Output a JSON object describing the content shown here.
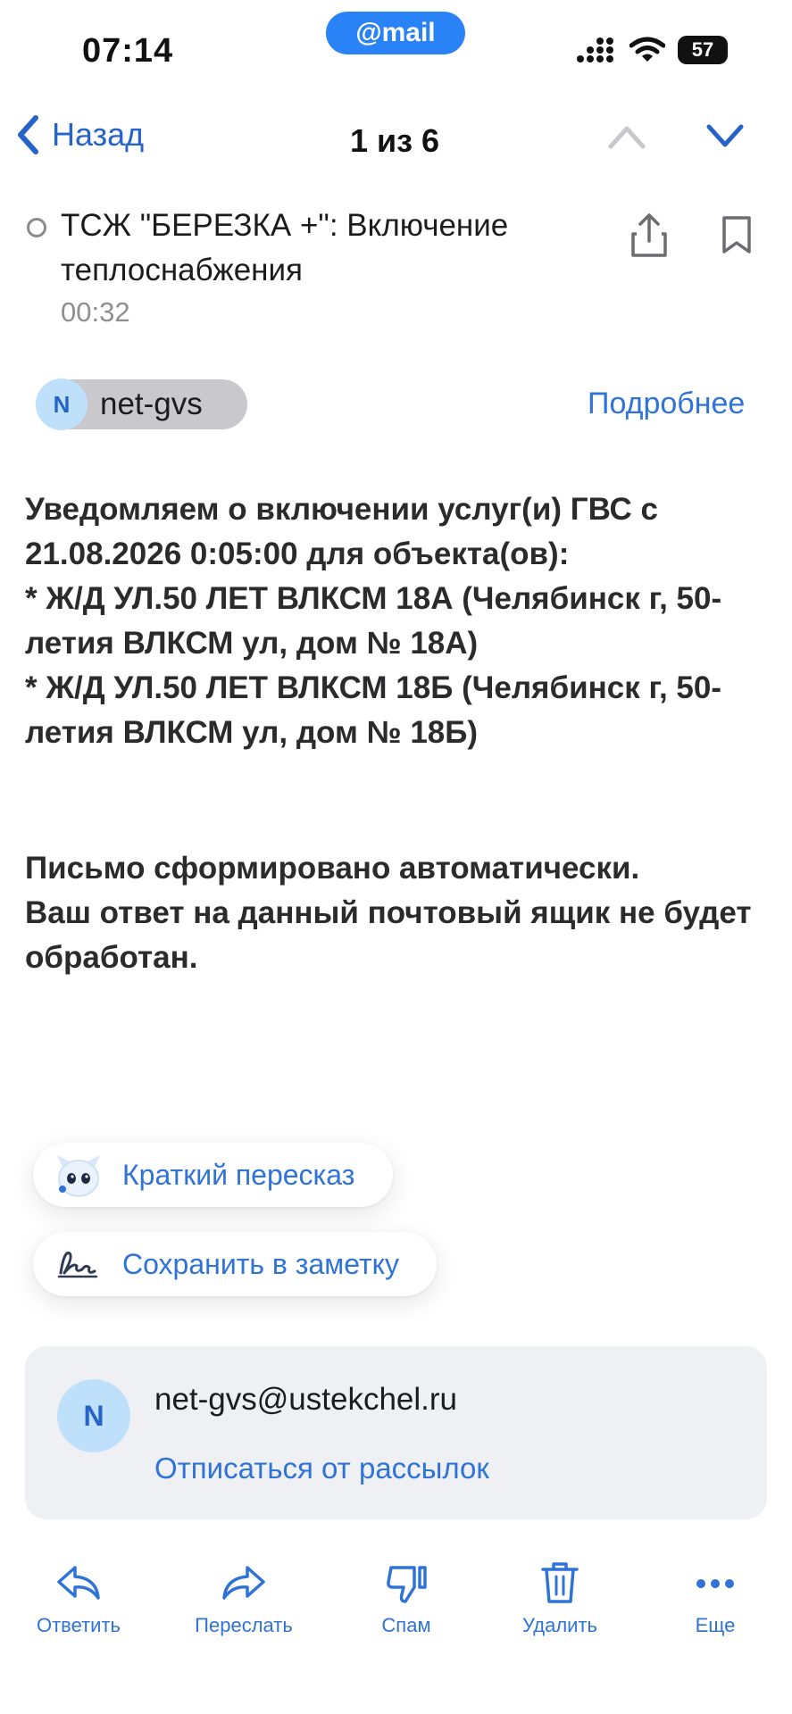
{
  "status_bar": {
    "time": "07:14",
    "battery": "57",
    "app_badge": "@mail"
  },
  "nav": {
    "back_label": "Назад",
    "counter": "1 из 6"
  },
  "message": {
    "subject": "ТСЖ \"БЕРЕЗКА +\": Включение теплоснабжения",
    "time": "00:32",
    "sender_initial": "N",
    "sender_name": "net-gvs",
    "details_label": "Подробнее",
    "body_part1": "Уведомляем о включении услуг(и) ГВС с 21.08.2026 0:05:00 для объекта(ов):\n* Ж/Д УЛ.50 ЛЕТ ВЛКСМ 18А (Челябинск г, 50-летия ВЛКСМ ул, дом № 18А)\n* Ж/Д УЛ.50 ЛЕТ ВЛКСМ 18Б (Челябинск г, 50-летия ВЛКСМ ул, дом № 18Б)",
    "body_part2": "Письмо сформировано автоматически.\nВаш ответ на данный почтовый ящик не будет обработан."
  },
  "actions": {
    "summary_label": "Краткий пересказ",
    "save_note_label": "Сохранить в заметку"
  },
  "sender_card": {
    "initial": "N",
    "email": "net-gvs@ustekchel.ru",
    "unsubscribe_label": "Отписаться от рассылок"
  },
  "toolbar": {
    "reply": "Ответить",
    "forward": "Переслать",
    "spam": "Спам",
    "delete": "Удалить",
    "more": "Еще"
  },
  "colors": {
    "accent": "#2f73d6",
    "brand": "#2a83f6",
    "card_bg": "#eef0f4"
  }
}
